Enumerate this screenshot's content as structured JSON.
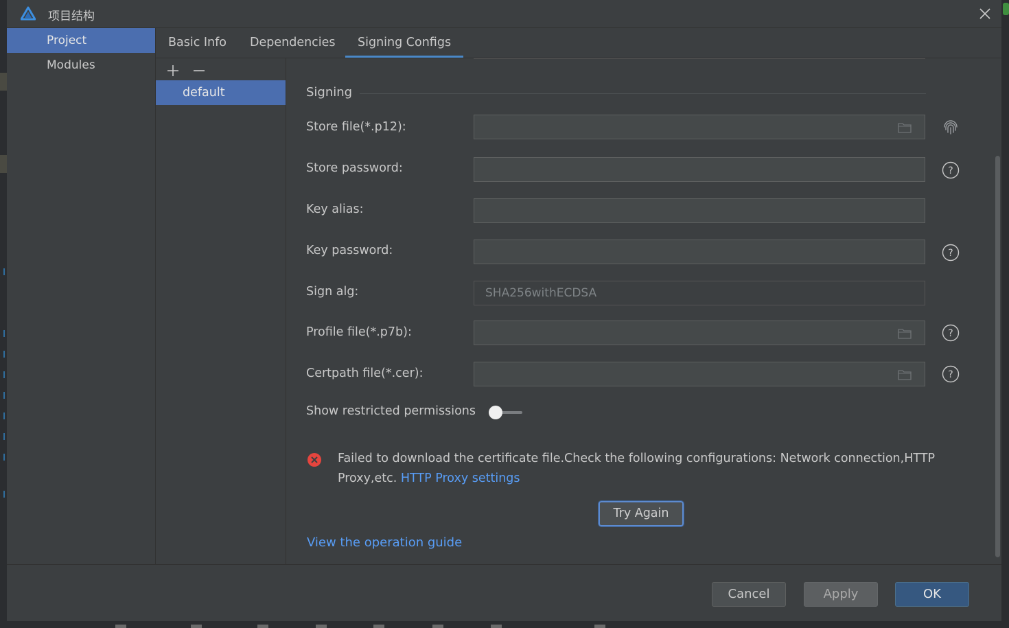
{
  "window": {
    "title": "项目结构"
  },
  "sidebar": {
    "items": [
      {
        "label": "Project",
        "active": true
      },
      {
        "label": "Modules",
        "active": false
      }
    ]
  },
  "tabs": [
    {
      "label": "Basic Info"
    },
    {
      "label": "Dependencies"
    },
    {
      "label": "Signing Configs",
      "active": true
    }
  ],
  "configs": {
    "items": [
      {
        "label": "default"
      }
    ]
  },
  "signing": {
    "section_title": "Signing",
    "fields": {
      "store_file": {
        "label": "Store file(*.p12):",
        "value": ""
      },
      "store_password": {
        "label": "Store password:",
        "value": ""
      },
      "key_alias": {
        "label": "Key alias:",
        "value": ""
      },
      "key_password": {
        "label": "Key password:",
        "value": ""
      },
      "sign_alg": {
        "label": "Sign alg:",
        "value": "SHA256withECDSA"
      },
      "profile_file": {
        "label": "Profile file(*.p7b):",
        "value": ""
      },
      "certpath_file": {
        "label": "Certpath file(*.cer):",
        "value": ""
      }
    },
    "restricted_label": "Show restricted permissions",
    "error_line1": "Failed to download the certificate file.Check the following configurations: Network connection,HTTP",
    "error_line2": "Proxy,etc.",
    "proxy_link": "HTTP Proxy settings",
    "try_again": "Try Again",
    "guide_link": "View the operation guide"
  },
  "footer": {
    "cancel": "Cancel",
    "apply": "Apply",
    "ok": "OK"
  },
  "colors": {
    "accent": "#4b6eaf",
    "link": "#589df6",
    "error": "#e5453e"
  }
}
